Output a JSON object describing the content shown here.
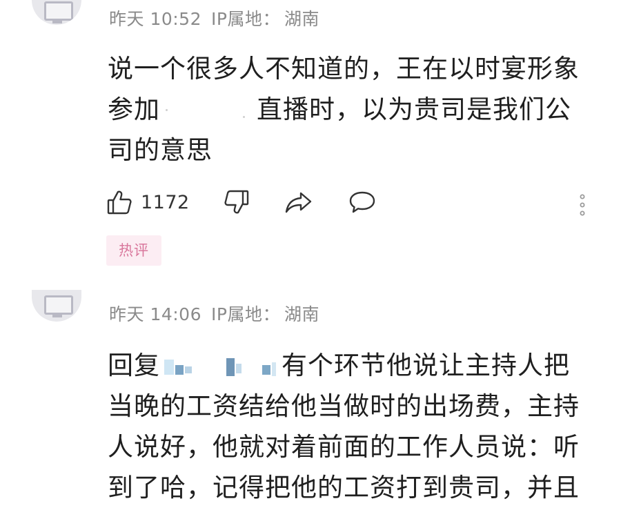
{
  "comments": [
    {
      "time": "昨天 10:52",
      "location_label": "IP属地：",
      "location": "湖南",
      "lines": [
        "说一个很多人不知道的，王在以时宴形象",
        "参加",
        "直播时，以为贵司是我们公",
        "司的意思"
      ],
      "likes": "1172",
      "badge": "热评"
    },
    {
      "time": "昨天 14:06",
      "location_label": "IP属地：",
      "location": "湖南",
      "reply_prefix": "回复",
      "lines": [
        "有个环节他说让主持人把",
        "当晚的工资结给他当做时的出场费，主持",
        "人说好，他就对着前面的工作人员说：听",
        "到了哈，记得把他的工资打到贵司，并且"
      ]
    }
  ],
  "icons": {
    "like": "thumbs-up-icon",
    "dislike": "thumbs-down-icon",
    "share": "share-arrow-icon",
    "reply": "speech-bubble-icon",
    "more": "vertical-dots-icon"
  },
  "colors": {
    "badge_bg": "#fcedf3",
    "badge_text": "#d9779c",
    "meta_text": "#8a8a8a"
  }
}
